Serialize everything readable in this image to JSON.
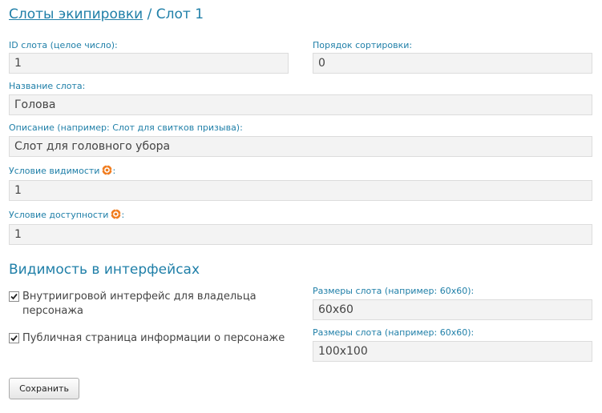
{
  "header": {
    "breadcrumb_link": "Слоты экипировки",
    "separator": " / ",
    "current": "Слот 1"
  },
  "fields": {
    "slot_id": {
      "label": "ID слота (целое число):",
      "value": "1"
    },
    "sort_order": {
      "label": "Порядок сортировки:",
      "value": "0"
    },
    "slot_name": {
      "label": "Название слота:",
      "value": "Голова"
    },
    "description": {
      "label": "Описание (например: Слот для свитков призыва):",
      "value": "Слот для головного убора"
    },
    "visibility_condition": {
      "label": "Условие видимости",
      "suffix": ":",
      "value": "1",
      "icon": "gear-icon"
    },
    "availability_condition": {
      "label": "Условие доступности",
      "suffix": ":",
      "value": "1",
      "icon": "gear-icon"
    }
  },
  "interfaces": {
    "title": "Видимость в интерфейсах",
    "checkboxes": [
      {
        "label_line1": "Внутриигровой интерфейс для владельца",
        "label_line2": "персонажа",
        "checked": true
      },
      {
        "label_line1": "Публичная страница информации о персонаже",
        "checked": true
      }
    ],
    "sizes": [
      {
        "label": "Размеры слота (например: 60x60):",
        "value": "60x60"
      },
      {
        "label": "Размеры слота (например: 60x60):",
        "value": "100x100"
      }
    ]
  },
  "actions": {
    "save_label": "Сохранить"
  },
  "colors": {
    "accent": "#1f7fa8",
    "field_bg": "#f3f3f3",
    "gear": "#f07c1e"
  }
}
